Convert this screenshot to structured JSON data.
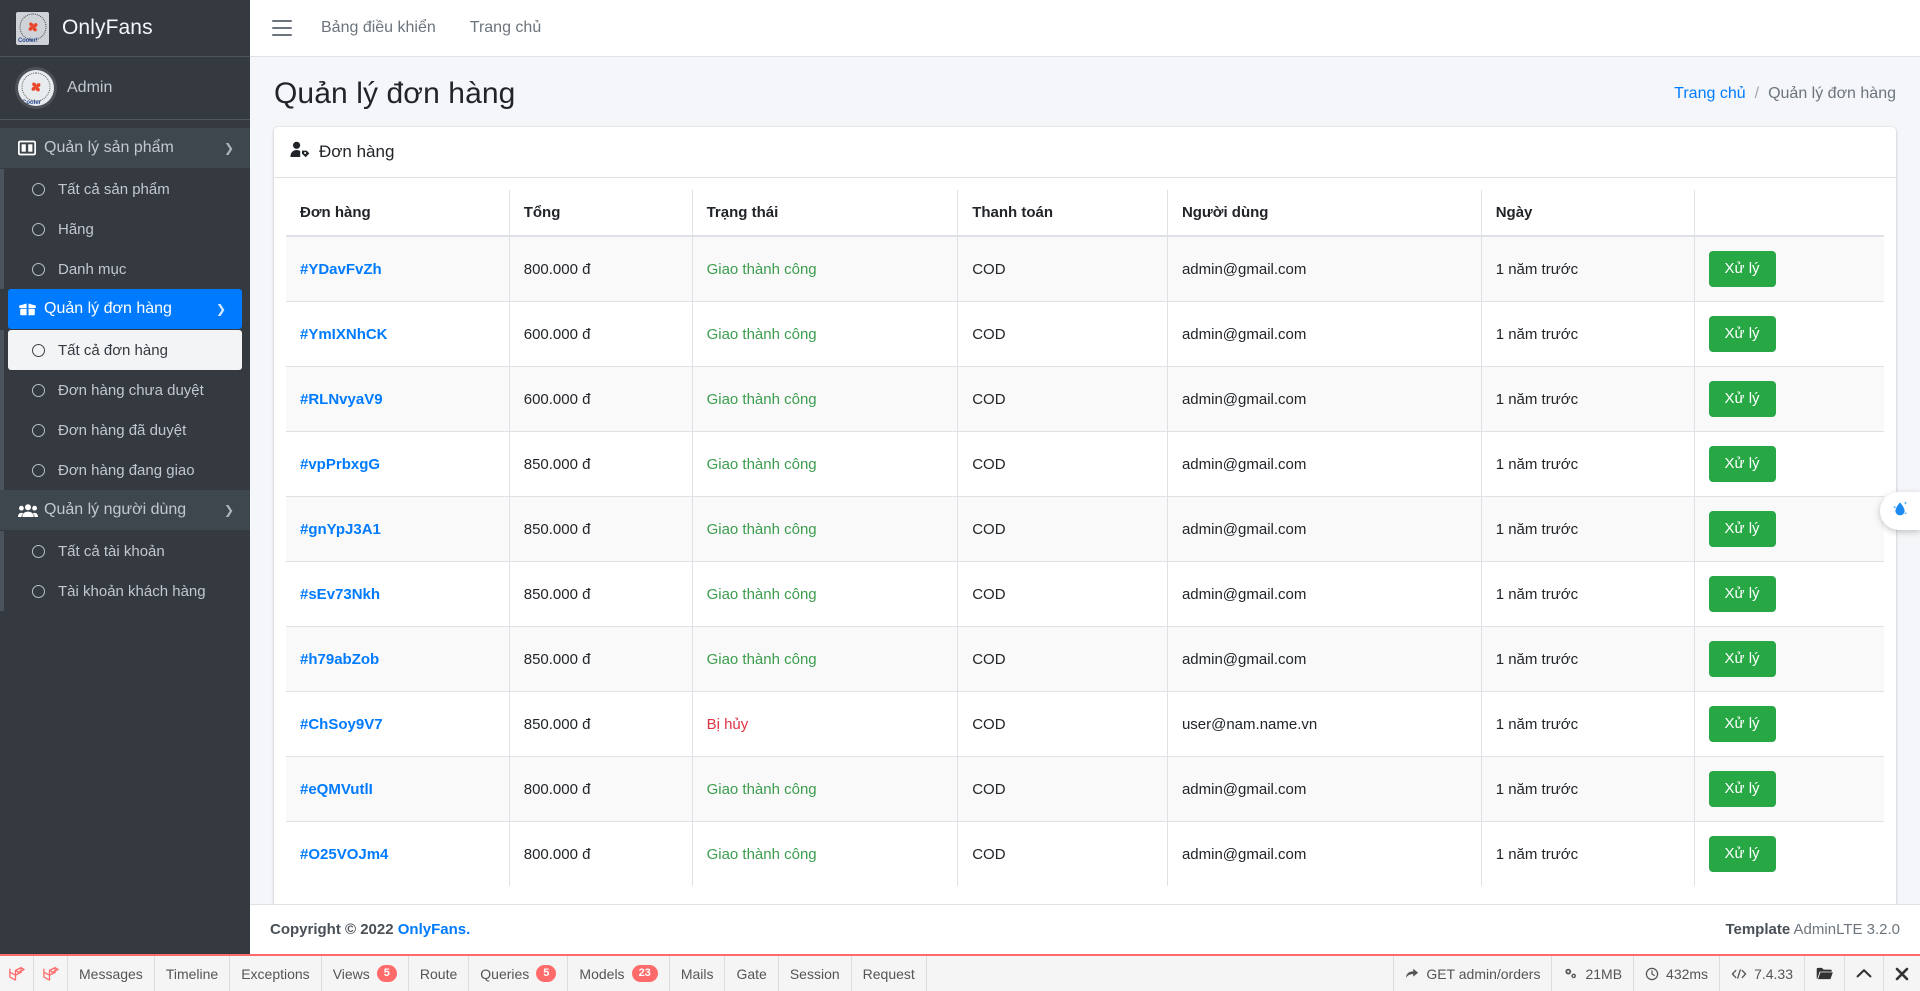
{
  "brand": {
    "name": "OnlyFans",
    "logo_icon": "fan-logo-icon"
  },
  "user_panel": {
    "name": "Admin",
    "avatar_icon": "avatar-icon"
  },
  "sidebar": {
    "groups": [
      {
        "label": "Quản lý sản phẩm",
        "icon": "columns-icon",
        "chevron": "chevron-down-icon",
        "active": false,
        "items": [
          {
            "label": "Tất cả sản phẩm"
          },
          {
            "label": "Hãng"
          },
          {
            "label": "Danh mục"
          }
        ]
      },
      {
        "label": "Quản lý đơn hàng",
        "icon": "box-open-icon",
        "chevron": "chevron-down-icon",
        "active": true,
        "items": [
          {
            "label": "Tất cả đơn hàng",
            "current": true
          },
          {
            "label": "Đơn hàng chưa duyệt"
          },
          {
            "label": "Đơn hàng đã duyệt"
          },
          {
            "label": "Đơn hàng đang giao"
          }
        ]
      },
      {
        "label": "Quản lý người dùng",
        "icon": "users-icon",
        "chevron": "chevron-down-icon",
        "active": false,
        "items": [
          {
            "label": "Tất cả tài khoản"
          },
          {
            "label": "Tài khoản khách hàng"
          }
        ]
      }
    ]
  },
  "navbar": {
    "toggle_icon": "hamburger-icon",
    "links": [
      "Bảng điều khiển",
      "Trang chủ"
    ]
  },
  "header": {
    "title": "Quản lý đơn hàng",
    "breadcrumb": {
      "home": "Trang chủ",
      "separator": "/",
      "current": "Quản lý đơn hàng"
    }
  },
  "card": {
    "header_icon": "user-tag-icon",
    "header_title": "Đơn hàng",
    "columns": [
      "Đơn hàng",
      "Tổng",
      "Trạng thái",
      "Thanh toán",
      "Người dùng",
      "Ngày",
      ""
    ],
    "action_label": "Xử lý",
    "rows": [
      {
        "order": "#YDavFvZh",
        "total": "800.000 đ",
        "status": "Giao thành công",
        "status_kind": "ok",
        "payment": "COD",
        "user": "admin@gmail.com",
        "date": "1 năm trước"
      },
      {
        "order": "#YmIXNhCK",
        "total": "600.000 đ",
        "status": "Giao thành công",
        "status_kind": "ok",
        "payment": "COD",
        "user": "admin@gmail.com",
        "date": "1 năm trước"
      },
      {
        "order": "#RLNvyaV9",
        "total": "600.000 đ",
        "status": "Giao thành công",
        "status_kind": "ok",
        "payment": "COD",
        "user": "admin@gmail.com",
        "date": "1 năm trước"
      },
      {
        "order": "#vpPrbxgG",
        "total": "850.000 đ",
        "status": "Giao thành công",
        "status_kind": "ok",
        "payment": "COD",
        "user": "admin@gmail.com",
        "date": "1 năm trước"
      },
      {
        "order": "#gnYpJ3A1",
        "total": "850.000 đ",
        "status": "Giao thành công",
        "status_kind": "ok",
        "payment": "COD",
        "user": "admin@gmail.com",
        "date": "1 năm trước"
      },
      {
        "order": "#sEv73Nkh",
        "total": "850.000 đ",
        "status": "Giao thành công",
        "status_kind": "ok",
        "payment": "COD",
        "user": "admin@gmail.com",
        "date": "1 năm trước"
      },
      {
        "order": "#h79abZob",
        "total": "850.000 đ",
        "status": "Giao thành công",
        "status_kind": "ok",
        "payment": "COD",
        "user": "admin@gmail.com",
        "date": "1 năm trước"
      },
      {
        "order": "#ChSoy9V7",
        "total": "850.000 đ",
        "status": "Bị hủy",
        "status_kind": "cancel",
        "payment": "COD",
        "user": "user@nam.name.vn",
        "date": "1 năm trước"
      },
      {
        "order": "#eQMVutlI",
        "total": "800.000 đ",
        "status": "Giao thành công",
        "status_kind": "ok",
        "payment": "COD",
        "user": "admin@gmail.com",
        "date": "1 năm trước"
      },
      {
        "order": "#O25VOJm4",
        "total": "800.000 đ",
        "status": "Giao thành công",
        "status_kind": "ok",
        "payment": "COD",
        "user": "admin@gmail.com",
        "date": "1 năm trước"
      }
    ]
  },
  "footer": {
    "copyright_prefix": "Copyright © 2022 ",
    "copyright_link": "OnlyFans.",
    "template_label": "Template",
    "template_value": "AdminLTE 3.2.0"
  },
  "float_widget": {
    "icon": "water-drop-icon"
  },
  "debugbar": {
    "logo_icon": "laravel-icon",
    "left_items": [
      {
        "label": "Messages",
        "badge": ""
      },
      {
        "label": "Timeline",
        "badge": ""
      },
      {
        "label": "Exceptions",
        "badge": ""
      },
      {
        "label": "Views",
        "badge": "5"
      },
      {
        "label": "Route",
        "badge": ""
      },
      {
        "label": "Queries",
        "badge": "5"
      },
      {
        "label": "Models",
        "badge": "23"
      },
      {
        "label": "Mails",
        "badge": ""
      },
      {
        "label": "Gate",
        "badge": ""
      },
      {
        "label": "Session",
        "badge": ""
      },
      {
        "label": "Request",
        "badge": ""
      }
    ],
    "right_items": [
      {
        "icon": "share-arrow-icon",
        "label": "GET admin/orders"
      },
      {
        "icon": "cogs-icon",
        "label": "21MB"
      },
      {
        "icon": "clock-icon",
        "label": "432ms"
      },
      {
        "icon": "code-icon",
        "label": "7.4.33"
      }
    ],
    "controls": [
      {
        "icon": "folder-icon"
      },
      {
        "icon": "chevron-up-icon"
      },
      {
        "icon": "close-icon"
      }
    ]
  },
  "colors": {
    "sidebar_bg": "#343a40",
    "accent_blue": "#007bff",
    "success_green": "#28a745",
    "status_ok": "#3c9d4e",
    "status_cancel": "#dc3545",
    "total_orange": "#f5b97a",
    "debug_red": "#ff6b6b"
  }
}
